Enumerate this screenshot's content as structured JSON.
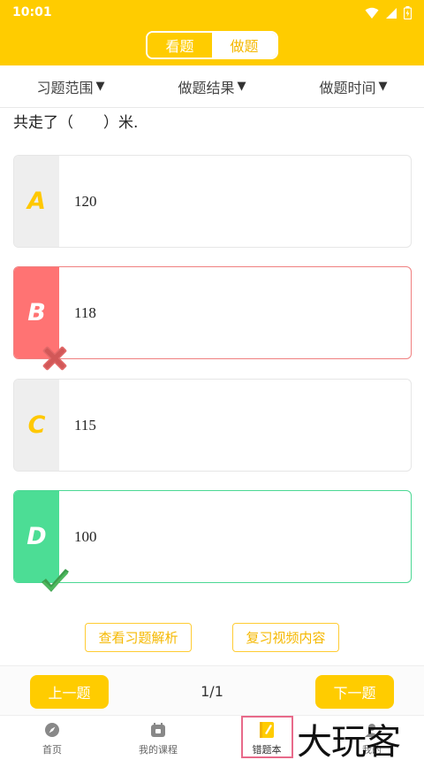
{
  "status_bar": {
    "time": "10:01"
  },
  "header": {
    "tabs": [
      {
        "label": "看题",
        "active": false
      },
      {
        "label": "做题",
        "active": true
      }
    ],
    "accent_color": "#FFCC00"
  },
  "filters": [
    {
      "label": "习题范围"
    },
    {
      "label": "做题结果"
    },
    {
      "label": "做题时间"
    }
  ],
  "question": {
    "text": "共走了（　　）米."
  },
  "options": [
    {
      "letter": "A",
      "value": "120",
      "state": "neutral"
    },
    {
      "letter": "B",
      "value": "118",
      "state": "wrong"
    },
    {
      "letter": "C",
      "value": "115",
      "state": "neutral"
    },
    {
      "letter": "D",
      "value": "100",
      "state": "correct"
    }
  ],
  "actions": {
    "analysis_label": "查看习题解析",
    "video_label": "复习视频内容"
  },
  "pager": {
    "prev_label": "上一题",
    "next_label": "下一题",
    "count": "1/1"
  },
  "tabbar": [
    {
      "label": "首页",
      "icon": "compass-icon"
    },
    {
      "label": "我的课程",
      "icon": "calendar-icon"
    },
    {
      "label": "错题本",
      "icon": "notebook-icon",
      "active": true
    },
    {
      "label": "我的",
      "icon": "person-icon"
    }
  ],
  "watermark": {
    "text": "大玩客"
  }
}
